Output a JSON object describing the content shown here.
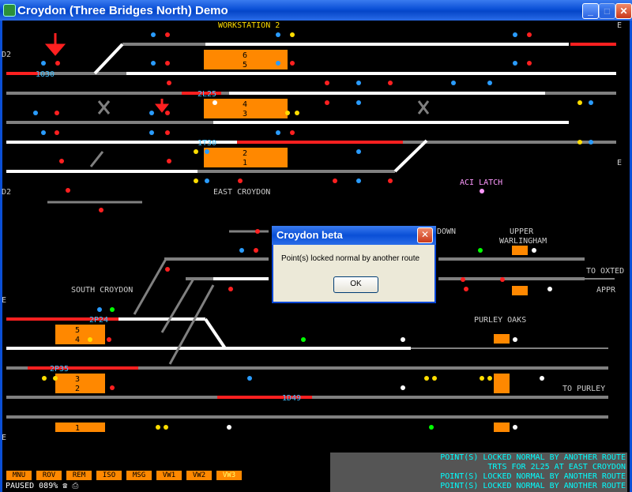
{
  "window": {
    "title": "Croydon (Three Bridges North) Demo"
  },
  "labels": {
    "workstation": "WORKSTATION 2",
    "east_croydon": "EAST CROYDON",
    "aci_latch": "ACI LATCH",
    "south_croydon": "SOUTH CROYDON",
    "upper_warlingham_1": "UPPER",
    "upper_warlingham_2": "WARLINGHAM",
    "to_oxted": "TO OXTED",
    "appr": "APPR",
    "purley_oaks": "PURLEY OAKS",
    "to_purley": "TO PURLEY",
    "down": "DOWN",
    "d2_top": "D2",
    "d2_bottom": "D2",
    "e_top": "E",
    "e_mid": "E",
    "e_left": "E",
    "e_left2": "E"
  },
  "berths": {
    "b1": "1O30",
    "b2": "2L25",
    "b3": "1T30",
    "b4": "2P24",
    "b5": "2P35",
    "b6": "1D49"
  },
  "platforms": {
    "p6": "6",
    "p5": "5",
    "p4": "4",
    "p3": "3",
    "p2": "2",
    "p1": "1",
    "s5": "5",
    "s4": "4",
    "s3": "3",
    "s2": "2",
    "s1": "1"
  },
  "dialog": {
    "title": "Croydon beta",
    "close": "✕",
    "message": "Point(s) locked normal by another route",
    "ok": "OK"
  },
  "menu": [
    "MNU",
    "ROV",
    "REM",
    "ISO",
    "MSG",
    "VW1",
    "VW2",
    "VW3"
  ],
  "status": {
    "paused": "PAUSED",
    "percent": "089%"
  },
  "messages": [
    "POINT(S) LOCKED NORMAL BY ANOTHER ROUTE",
    "TRTS FOR 2L25 AT EAST CROYDON",
    "POINT(S) LOCKED NORMAL BY ANOTHER ROUTE",
    "POINT(S) LOCKED NORMAL BY ANOTHER ROUTE"
  ],
  "colors": {
    "track": "#808080",
    "route": "#ffffff",
    "occupied": "#ff2020",
    "platform": "#ff8800",
    "berth": "#40c0ff",
    "accent": "#0a4fd6"
  }
}
